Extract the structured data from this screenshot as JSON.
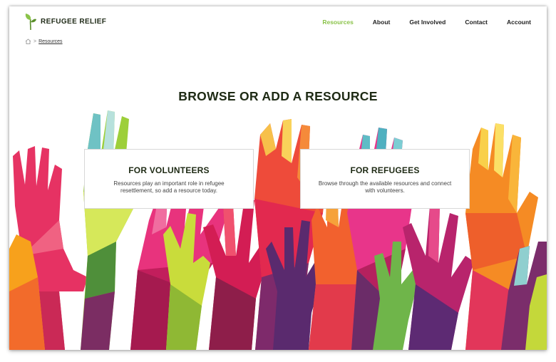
{
  "brand": {
    "name": "REFUGEE RELIEF",
    "logo_icon": "sprout-icon"
  },
  "nav": {
    "items": [
      {
        "label": "Resources",
        "active": true
      },
      {
        "label": "About",
        "active": false
      },
      {
        "label": "Get Involved",
        "active": false
      },
      {
        "label": "Contact",
        "active": false
      },
      {
        "label": "Account",
        "active": false
      }
    ],
    "active_color": "#8bc34a"
  },
  "breadcrumb": {
    "home_icon": "home-icon",
    "separator": ">",
    "current": "Resources"
  },
  "page": {
    "title": "BROWSE OR ADD A RESOURCE"
  },
  "cards": {
    "volunteers": {
      "title": "FOR VOLUNTEERS",
      "text": "Resources play an important role in refugee resettlement, so add a resource today."
    },
    "refugees": {
      "title": "FOR REFUGEES",
      "text": "Browse through the available resources and connect with volunteers."
    }
  },
  "hero_image": {
    "name": "raised-hands-illustration"
  }
}
